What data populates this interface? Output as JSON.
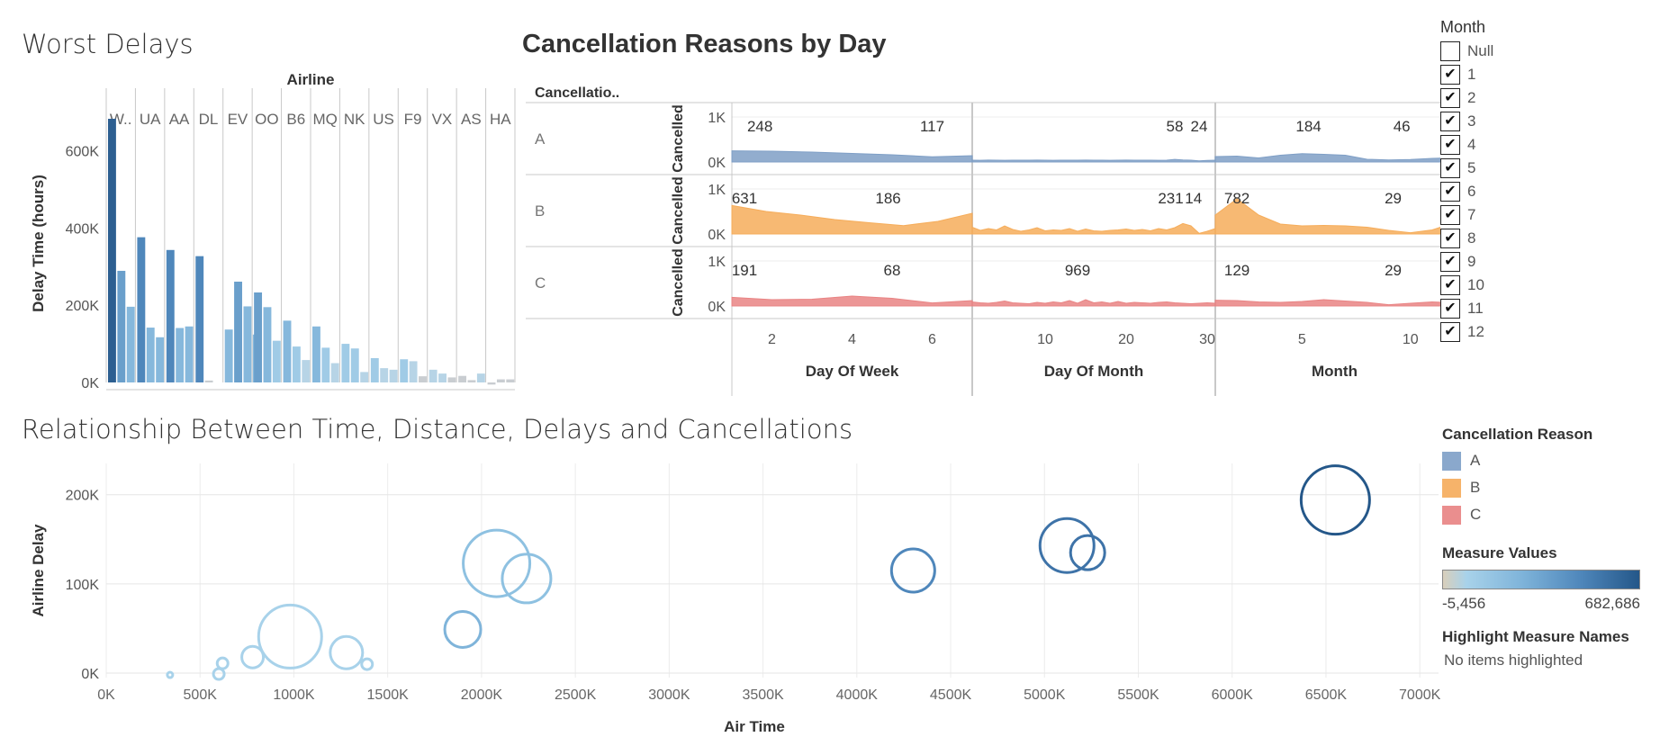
{
  "worst_delays": {
    "title": "Worst Delays"
  },
  "cancellation": {
    "title": "Cancellation Reasons by Day"
  },
  "relationship": {
    "title": "Relationship Between Time, Distance, Delays and Cancellations"
  },
  "month_filter": {
    "title": "Month",
    "items": [
      {
        "label": "Null",
        "checked": false
      },
      {
        "label": "1",
        "checked": true
      },
      {
        "label": "2",
        "checked": true
      },
      {
        "label": "3",
        "checked": true
      },
      {
        "label": "4",
        "checked": true
      },
      {
        "label": "5",
        "checked": true
      },
      {
        "label": "6",
        "checked": true
      },
      {
        "label": "7",
        "checked": true
      },
      {
        "label": "8",
        "checked": true
      },
      {
        "label": "9",
        "checked": true
      },
      {
        "label": "10",
        "checked": true
      },
      {
        "label": "11",
        "checked": true
      },
      {
        "label": "12",
        "checked": true
      }
    ]
  },
  "cancel_legend": {
    "title": "Cancellation Reason",
    "items": [
      {
        "label": "A",
        "color": "#8aa8cc"
      },
      {
        "label": "B",
        "color": "#f6b36a"
      },
      {
        "label": "C",
        "color": "#ea8e8e"
      }
    ]
  },
  "measure_legend": {
    "title": "Measure Values",
    "min": "-5,456",
    "max": "682,686"
  },
  "highlight": {
    "title": "Highlight Measure Names",
    "value": "No items highlighted"
  },
  "chart_data": [
    {
      "type": "bar",
      "title": "Worst Delays",
      "xlabel": "Airline",
      "ylabel": "Delay Time (hours)",
      "ylim": [
        0,
        720000
      ],
      "yticks": [
        "0K",
        "200K",
        "400K",
        "600K"
      ],
      "categories": [
        "W..",
        "UA",
        "AA",
        "DL",
        "EV",
        "OO",
        "B6",
        "MQ",
        "NK",
        "US",
        "F9",
        "VX",
        "AS",
        "HA"
      ],
      "bars_per_category": [
        [
          682686,
          289000,
          196000
        ],
        [
          376000,
          142000,
          117000
        ],
        [
          343000,
          141000,
          145000
        ],
        [
          327000,
          5000
        ],
        [
          137000,
          261000,
          197000,
          124000
        ],
        [
          233000,
          195000,
          108000
        ],
        [
          160000,
          93000,
          58000
        ],
        [
          145000,
          90000,
          50000
        ],
        [
          100000,
          88000,
          27000
        ],
        [
          63000,
          37000,
          33000
        ],
        [
          60000,
          55000,
          16000
        ],
        [
          33000,
          23000,
          13000
        ],
        [
          17000,
          6000,
          23000
        ],
        [
          -5456,
          8000,
          8000
        ]
      ]
    },
    {
      "type": "area",
      "title": "Cancellation Reasons by Day",
      "row_header": "Cancellatio..",
      "row_labels": [
        "A",
        "B",
        "C"
      ],
      "ylabel": "Cancelled",
      "ylim": [
        0,
        1000
      ],
      "yticks": [
        "0K",
        "1K"
      ],
      "panels": [
        {
          "xlabel": "Day Of Week",
          "xlim": [
            1,
            7
          ],
          "xticks": [
            "2",
            "4",
            "6"
          ],
          "xtick_values": [
            2,
            4,
            6
          ]
        },
        {
          "xlabel": "Day Of Month",
          "xlim": [
            1,
            31
          ],
          "xticks": [
            "10",
            "20",
            "30"
          ],
          "xtick_values": [
            10,
            20,
            30
          ]
        },
        {
          "xlabel": "Month",
          "xlim": [
            1,
            12
          ],
          "xticks": [
            "5",
            "10"
          ],
          "xtick_values": [
            5,
            10
          ]
        }
      ],
      "series": [
        {
          "name": "A",
          "color": "#7f9fc6",
          "values": [
            [
              248,
              240,
              220,
              190,
              160,
              117,
              140
            ],
            [
              40,
              38,
              42,
              40,
              38,
              41,
              40,
              39,
              42,
              40,
              38,
              41,
              40,
              39,
              42,
              40,
              41,
              38,
              40,
              42,
              39,
              40,
              41,
              38,
              40,
              58,
              45,
              40,
              24,
              35,
              40
            ],
            [
              120,
              130,
              90,
              150,
              184,
              170,
              150,
              60,
              46,
              55,
              80,
              90
            ]
          ],
          "labels": [
            [
              {
                "x": 1.7,
                "v": "248"
              },
              {
                "x": 6,
                "v": "117"
              }
            ],
            [
              {
                "x": 26,
                "v": "58"
              },
              {
                "x": 29,
                "v": "24"
              }
            ],
            [
              {
                "x": 5.3,
                "v": "184"
              },
              {
                "x": 9.6,
                "v": "46"
              }
            ]
          ]
        },
        {
          "name": "B",
          "color": "#f6ad5b",
          "values": [
            [
              631,
              500,
              420,
              320,
              250,
              186,
              280,
              460
            ],
            [
              150,
              80,
              120,
              90,
              180,
              100,
              60,
              90,
              140,
              70,
              90,
              80,
              120,
              60,
              110,
              70,
              60,
              80,
              90,
              110,
              80,
              100,
              70,
              120,
              90,
              140,
              231,
              180,
              14,
              60,
              120
            ],
            [
              420,
              782,
              420,
              220,
              180,
              190,
              180,
              150,
              80,
              29,
              90,
              250
            ]
          ],
          "labels": [
            [
              {
                "x": 1,
                "v": "631"
              },
              {
                "x": 4.9,
                "v": "186"
              }
            ],
            [
              {
                "x": 25.5,
                "v": "231"
              },
              {
                "x": 28.3,
                "v": "14"
              }
            ],
            [
              {
                "x": 2,
                "v": "782"
              },
              {
                "x": 9.2,
                "v": "29"
              }
            ]
          ]
        },
        {
          "name": "C",
          "color": "#e98484",
          "values": [
            [
              191,
              140,
              150,
              220,
              170,
              68,
              120
            ],
            [
              90,
              70,
              60,
              80,
              110,
              70,
              60,
              50,
              80,
              60,
              90,
              70,
              120,
              60,
              140,
              70,
              90,
              60,
              100,
              60,
              80,
              70,
              60,
              80,
              90,
              70,
              60,
              50,
              60,
              70,
              60
            ],
            [
              129,
              120,
              90,
              80,
              100,
              140,
              110,
              80,
              29,
              60,
              90,
              70
            ]
          ],
          "labels": [
            [
              {
                "x": 1,
                "v": "191"
              },
              {
                "x": 5,
                "v": "68"
              }
            ],
            [
              {
                "x": 14,
                "v": "969"
              }
            ],
            [
              {
                "x": 2,
                "v": "129"
              },
              {
                "x": 9.2,
                "v": "29"
              }
            ]
          ]
        }
      ]
    },
    {
      "type": "scatter",
      "title": "Relationship Between Time, Distance, Delays and Cancellations",
      "xlabel": "Air Time",
      "ylabel": "Airline Delay",
      "xlim": [
        0,
        7100000
      ],
      "ylim": [
        -5000,
        235000
      ],
      "xticks": [
        "0K",
        "500K",
        "1000K",
        "1500K",
        "2000K",
        "2500K",
        "3000K",
        "3500K",
        "4000K",
        "4500K",
        "5000K",
        "5500K",
        "6000K",
        "6500K",
        "7000K"
      ],
      "xtick_values": [
        0,
        500000,
        1000000,
        1500000,
        2000000,
        2500000,
        3000000,
        3500000,
        4000000,
        4500000,
        5000000,
        5500000,
        6000000,
        6500000,
        7000000
      ],
      "yticks": [
        "0K",
        "100K",
        "200K"
      ],
      "ytick_values": [
        0,
        100000,
        200000
      ],
      "points": [
        {
          "x": 340000,
          "y": -2000,
          "size": 3,
          "color": "#a8d2ea"
        },
        {
          "x": 600000,
          "y": -1000,
          "size": 6,
          "color": "#a8d2ea"
        },
        {
          "x": 620000,
          "y": 11000,
          "size": 6,
          "color": "#a8d2ea"
        },
        {
          "x": 780000,
          "y": 18000,
          "size": 12,
          "color": "#a8d2ea"
        },
        {
          "x": 980000,
          "y": 41000,
          "size": 35,
          "color": "#a8d2ea"
        },
        {
          "x": 1280000,
          "y": 23000,
          "size": 18,
          "color": "#a8d2ea"
        },
        {
          "x": 1390000,
          "y": 10000,
          "size": 6,
          "color": "#a8d2ea"
        },
        {
          "x": 1900000,
          "y": 49000,
          "size": 20,
          "color": "#7fb4da"
        },
        {
          "x": 2080000,
          "y": 123000,
          "size": 37,
          "color": "#8ec1e1"
        },
        {
          "x": 2240000,
          "y": 106000,
          "size": 27,
          "color": "#8ec1e1"
        },
        {
          "x": 4300000,
          "y": 115000,
          "size": 24,
          "color": "#4f87bb"
        },
        {
          "x": 5120000,
          "y": 143000,
          "size": 30,
          "color": "#3e73a8"
        },
        {
          "x": 5230000,
          "y": 135000,
          "size": 19,
          "color": "#3e73a8"
        },
        {
          "x": 6550000,
          "y": 194000,
          "size": 38,
          "color": "#245789"
        }
      ]
    }
  ]
}
